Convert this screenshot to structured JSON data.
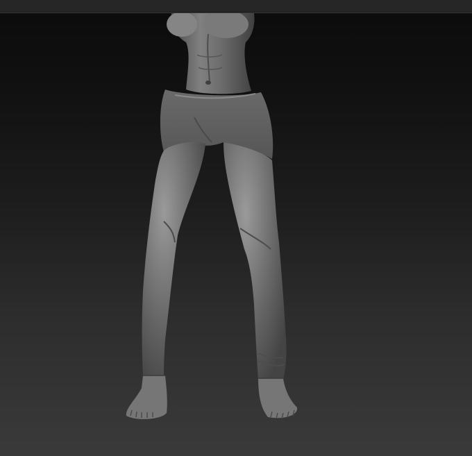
{
  "app": {
    "top_strip_label": ""
  },
  "viewport": {
    "model_icon": "sculpt-model-icon"
  },
  "colors": {
    "background_top": "#0b0b0b",
    "background_bottom": "#3a3a3a",
    "model_base": "#6b6b6b",
    "model_highlight": "#8f8f8f",
    "model_shadow": "#3f3f3f"
  }
}
